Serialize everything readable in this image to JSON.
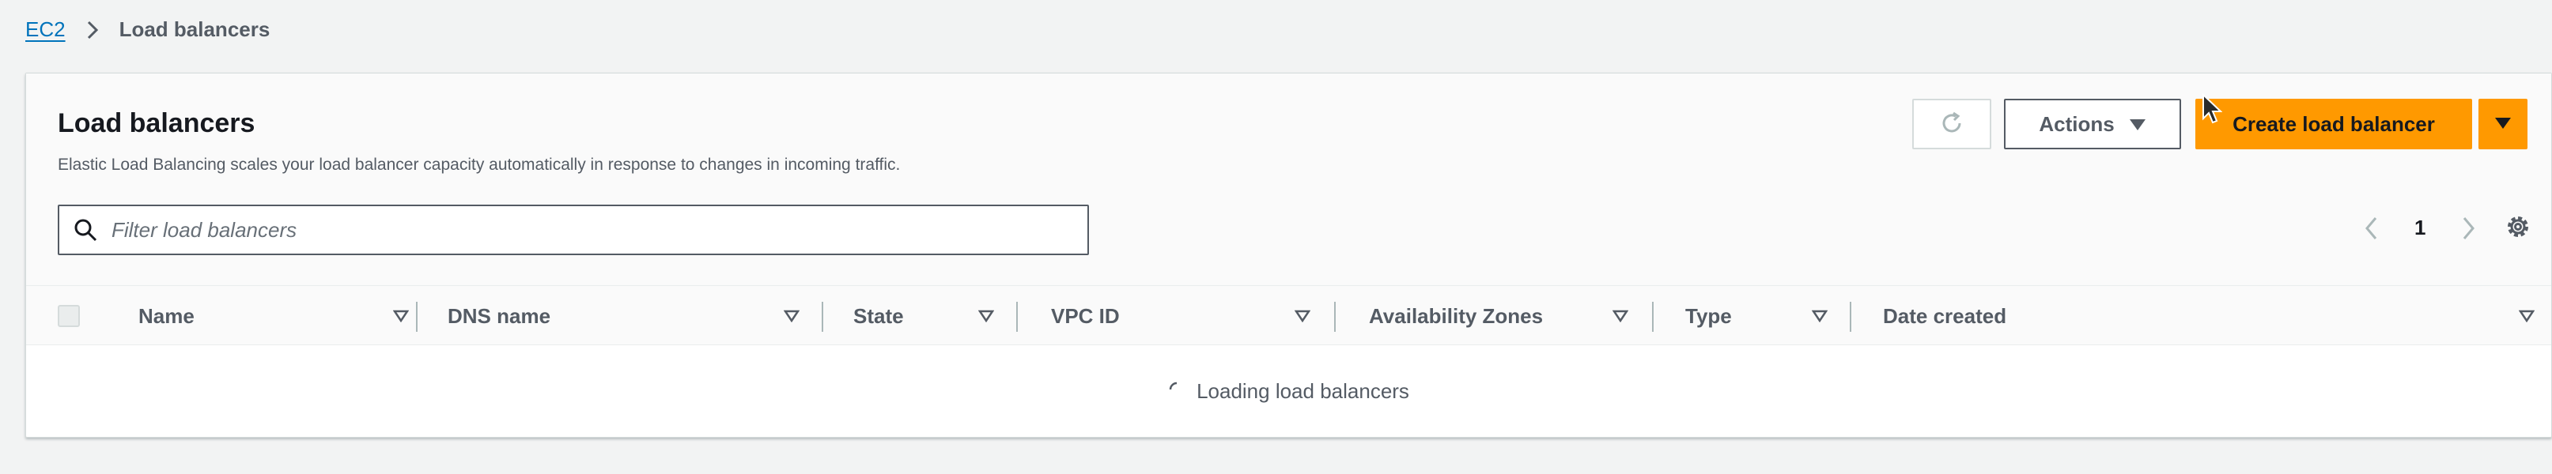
{
  "breadcrumb": {
    "parent": "EC2",
    "current": "Load balancers"
  },
  "header": {
    "title": "Load balancers",
    "description": "Elastic Load Balancing scales your load balancer capacity automatically in response to changes in incoming traffic."
  },
  "toolbar": {
    "refresh_icon": "refresh-icon",
    "actions_label": "Actions",
    "create_label": "Create load balancer"
  },
  "search": {
    "placeholder": "Filter load balancers",
    "value": ""
  },
  "pagination": {
    "current_page": "1"
  },
  "table": {
    "columns": [
      {
        "label": "Name"
      },
      {
        "label": "DNS name"
      },
      {
        "label": "State"
      },
      {
        "label": "VPC ID"
      },
      {
        "label": "Availability Zones"
      },
      {
        "label": "Type"
      },
      {
        "label": "Date created"
      }
    ],
    "loading_text": "Loading load balancers"
  },
  "colors": {
    "primary_button": "#ff9900",
    "link": "#0073bb",
    "text_secondary": "#545b64"
  }
}
